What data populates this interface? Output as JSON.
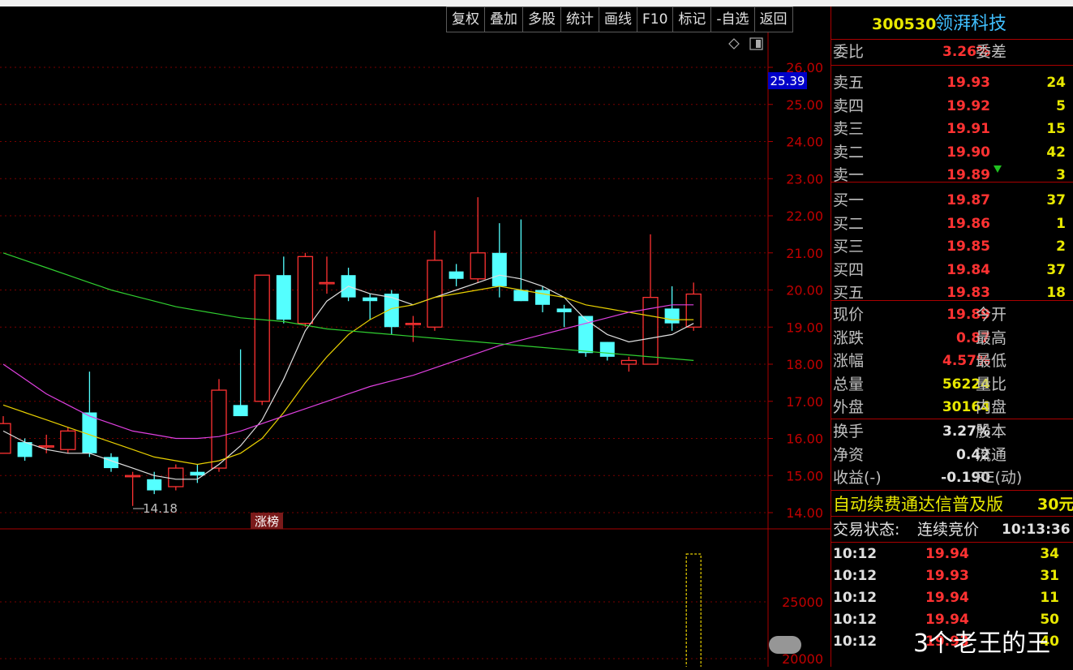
{
  "toolbar": {
    "buttons": [
      "复权",
      "叠加",
      "多股",
      "统计",
      "画线",
      "F10",
      "标记",
      "-自选",
      "返回"
    ]
  },
  "chart": {
    "icons": [
      "diamond-icon",
      "window-icon"
    ],
    "price_axis_labels": [
      "26.00",
      "25.00",
      "24.00",
      "23.00",
      "22.00",
      "21.00",
      "20.00",
      "19.00",
      "18.00",
      "17.00",
      "16.00",
      "15.00",
      "14.00"
    ],
    "current_price_tag": "25.39",
    "low_marker": "14.18",
    "rank_badge": "涨榜",
    "volume_axis_labels": [
      "25000",
      "20000"
    ]
  },
  "chart_data": {
    "type": "candlestick",
    "ylim": [
      13.8,
      26.2
    ],
    "candles": [
      {
        "o": 15.6,
        "h": 16.6,
        "l": 15.6,
        "c": 16.4
      },
      {
        "o": 15.9,
        "h": 16.0,
        "l": 15.4,
        "c": 15.5
      },
      {
        "o": 15.8,
        "h": 16.1,
        "l": 15.6,
        "c": 15.8
      },
      {
        "o": 15.7,
        "h": 16.3,
        "l": 15.6,
        "c": 16.2
      },
      {
        "o": 16.7,
        "h": 17.8,
        "l": 15.5,
        "c": 15.6
      },
      {
        "o": 15.5,
        "h": 15.6,
        "l": 15.1,
        "c": 15.2
      },
      {
        "o": 15.0,
        "h": 15.1,
        "l": 14.18,
        "c": 15.0
      },
      {
        "o": 14.9,
        "h": 15.1,
        "l": 14.5,
        "c": 14.6
      },
      {
        "o": 14.7,
        "h": 15.3,
        "l": 14.6,
        "c": 15.2
      },
      {
        "o": 15.1,
        "h": 15.3,
        "l": 14.8,
        "c": 15.0
      },
      {
        "o": 15.2,
        "h": 17.6,
        "l": 15.1,
        "c": 17.3
      },
      {
        "o": 16.9,
        "h": 18.4,
        "l": 16.6,
        "c": 16.6
      },
      {
        "o": 17.0,
        "h": 20.4,
        "l": 16.9,
        "c": 20.4
      },
      {
        "o": 20.4,
        "h": 20.9,
        "l": 19.1,
        "c": 19.2
      },
      {
        "o": 19.1,
        "h": 21.0,
        "l": 19.0,
        "c": 20.9
      },
      {
        "o": 20.2,
        "h": 20.9,
        "l": 19.9,
        "c": 20.2
      },
      {
        "o": 20.4,
        "h": 20.6,
        "l": 19.7,
        "c": 19.8
      },
      {
        "o": 19.8,
        "h": 19.9,
        "l": 19.2,
        "c": 19.7
      },
      {
        "o": 19.9,
        "h": 20.0,
        "l": 18.8,
        "c": 19.0
      },
      {
        "o": 19.1,
        "h": 19.3,
        "l": 18.6,
        "c": 19.1
      },
      {
        "o": 19.0,
        "h": 21.6,
        "l": 18.9,
        "c": 20.8
      },
      {
        "o": 20.5,
        "h": 20.7,
        "l": 20.1,
        "c": 20.3
      },
      {
        "o": 20.3,
        "h": 22.5,
        "l": 20.2,
        "c": 21.0
      },
      {
        "o": 21.0,
        "h": 21.8,
        "l": 19.8,
        "c": 20.1
      },
      {
        "o": 20.0,
        "h": 21.9,
        "l": 19.7,
        "c": 19.7
      },
      {
        "o": 20.0,
        "h": 20.1,
        "l": 19.4,
        "c": 19.6
      },
      {
        "o": 19.5,
        "h": 19.6,
        "l": 19.0,
        "c": 19.4
      },
      {
        "o": 19.3,
        "h": 19.3,
        "l": 18.2,
        "c": 18.3
      },
      {
        "o": 18.6,
        "h": 18.6,
        "l": 18.1,
        "c": 18.2
      },
      {
        "o": 18.0,
        "h": 18.2,
        "l": 17.8,
        "c": 18.1
      },
      {
        "o": 18.0,
        "h": 21.5,
        "l": 18.0,
        "c": 19.8
      },
      {
        "o": 19.5,
        "h": 20.1,
        "l": 18.9,
        "c": 19.1
      },
      {
        "o": 19.0,
        "h": 20.2,
        "l": 18.9,
        "c": 19.89
      }
    ],
    "ma_white": [
      16.2,
      15.9,
      15.7,
      15.6,
      15.6,
      15.4,
      15.2,
      15.0,
      14.9,
      14.9,
      15.3,
      15.8,
      16.5,
      17.6,
      18.9,
      19.7,
      20.1,
      19.9,
      19.8,
      19.6,
      19.8,
      20.0,
      20.2,
      20.4,
      20.3,
      20.1,
      19.8,
      19.2,
      18.8,
      18.6,
      18.7,
      18.8,
      19.1
    ],
    "ma_yellow": [
      16.9,
      16.7,
      16.5,
      16.3,
      16.1,
      15.9,
      15.7,
      15.5,
      15.4,
      15.3,
      15.4,
      15.6,
      16.0,
      16.7,
      17.5,
      18.2,
      18.8,
      19.2,
      19.5,
      19.6,
      19.8,
      19.9,
      20.0,
      20.1,
      20.0,
      19.9,
      19.8,
      19.6,
      19.5,
      19.4,
      19.3,
      19.2,
      19.2
    ],
    "ma_magenta": [
      18.0,
      17.6,
      17.2,
      16.9,
      16.6,
      16.4,
      16.2,
      16.1,
      16.0,
      16.0,
      16.05,
      16.2,
      16.4,
      16.6,
      16.8,
      17.0,
      17.2,
      17.4,
      17.55,
      17.7,
      17.9,
      18.1,
      18.3,
      18.5,
      18.65,
      18.8,
      18.95,
      19.1,
      19.25,
      19.4,
      19.5,
      19.6,
      19.6
    ],
    "ma_green": [
      21.0,
      20.8,
      20.6,
      20.4,
      20.2,
      20.0,
      19.85,
      19.7,
      19.55,
      19.45,
      19.35,
      19.25,
      19.2,
      19.15,
      19.05,
      18.95,
      18.9,
      18.85,
      18.8,
      18.75,
      18.7,
      18.65,
      18.6,
      18.55,
      18.5,
      18.45,
      18.4,
      18.35,
      18.3,
      18.25,
      18.2,
      18.15,
      18.1
    ],
    "volume_ylim": [
      19800,
      26500
    ],
    "volume_last": 56224
  },
  "quote": {
    "code": "300530",
    "name": "领湃科技",
    "weibi_label": "委比",
    "weibi_value": "3.26%",
    "weicha_label": "委差",
    "asks": [
      {
        "label": "卖五",
        "price": "19.93",
        "qty": "24"
      },
      {
        "label": "卖四",
        "price": "19.92",
        "qty": "5"
      },
      {
        "label": "卖三",
        "price": "19.91",
        "qty": "15"
      },
      {
        "label": "卖二",
        "price": "19.90",
        "qty": "42"
      },
      {
        "label": "卖一",
        "price": "19.89",
        "qty": "3"
      }
    ],
    "bids": [
      {
        "label": "买一",
        "price": "19.87",
        "qty": "37"
      },
      {
        "label": "买二",
        "price": "19.86",
        "qty": "1"
      },
      {
        "label": "买三",
        "price": "19.85",
        "qty": "2"
      },
      {
        "label": "买四",
        "price": "19.84",
        "qty": "37"
      },
      {
        "label": "买五",
        "price": "19.83",
        "qty": "18"
      }
    ],
    "stats": [
      {
        "label": "现价",
        "value": "19.89",
        "label2": "今开"
      },
      {
        "label": "涨跌",
        "value": "0.87",
        "label2": "最高"
      },
      {
        "label": "涨幅",
        "value": "4.57%",
        "label2": "最低"
      },
      {
        "label": "总量",
        "value": "56224",
        "label2": "量比"
      },
      {
        "label": "外盘",
        "value": "30164",
        "label2": "内盘"
      }
    ],
    "fund": [
      {
        "label": "换手",
        "value": "3.27%",
        "label2": "股本"
      },
      {
        "label": "净资",
        "value": "0.42",
        "label2": "流通"
      },
      {
        "label": "收益(-)",
        "value": "-0.190",
        "label2": "PE(动)"
      }
    ],
    "ad": "自动续费通达信普及版",
    "ad_price": "30元",
    "status_label": "交易状态:",
    "status_value": "连续竞价",
    "status_time": "10:13:36",
    "ticks": [
      {
        "time": "10:12",
        "price": "19.94",
        "qty": "34"
      },
      {
        "time": "10:12",
        "price": "19.93",
        "qty": "31"
      },
      {
        "time": "10:12",
        "price": "19.94",
        "qty": "11"
      },
      {
        "time": "10:12",
        "price": "19.94",
        "qty": "50"
      },
      {
        "time": "10:12",
        "price": "19.93",
        "qty": "40"
      }
    ]
  },
  "watermark": {
    "text": "3个老王的王"
  }
}
